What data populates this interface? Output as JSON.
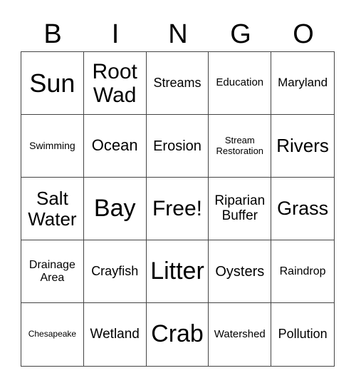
{
  "header": [
    "B",
    "I",
    "N",
    "G",
    "O"
  ],
  "cells": [
    "Sun",
    "Root Wad",
    "Streams",
    "Education",
    "Maryland",
    "Swimming",
    "Ocean",
    "Erosion",
    "Stream Restoration",
    "Rivers",
    "Salt Water",
    "Bay",
    "Free!",
    "Riparian Buffer",
    "Grass",
    "Drainage Area",
    "Crayfish",
    "Litter",
    "Oysters",
    "Raindrop",
    "Chesapeake",
    "Wetland",
    "Crab",
    "Watershed",
    "Pollution"
  ]
}
